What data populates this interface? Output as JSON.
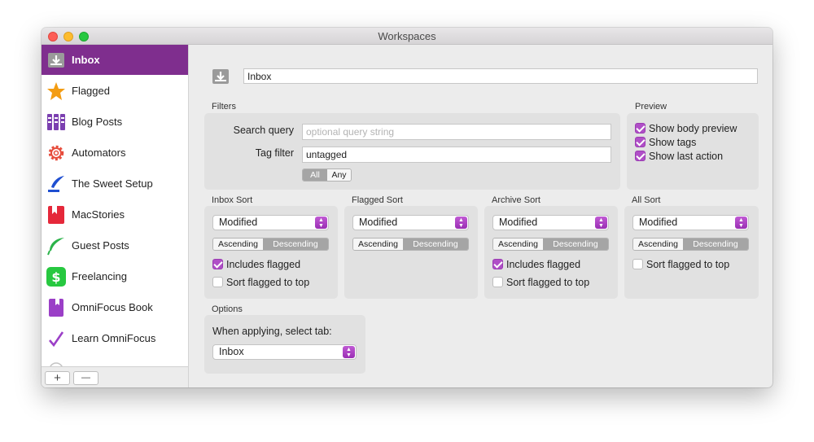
{
  "window": {
    "title": "Workspaces"
  },
  "sidebar": {
    "items": [
      {
        "label": "Inbox",
        "icon": "inbox-icon",
        "color": "#8e8e8e",
        "active": true
      },
      {
        "label": "Flagged",
        "icon": "star-icon",
        "color": "#f39c12"
      },
      {
        "label": "Blog Posts",
        "icon": "columns-icon",
        "color": "#7b3fb0"
      },
      {
        "label": "Automators",
        "icon": "gear-icon",
        "color": "#e74c3c"
      },
      {
        "label": "The Sweet Setup",
        "icon": "quill-icon",
        "color": "#1f4fd1"
      },
      {
        "label": "MacStories",
        "icon": "bookmark-icon",
        "color": "#e5283a"
      },
      {
        "label": "Guest Posts",
        "icon": "feather-icon",
        "color": "#2bb34a"
      },
      {
        "label": "Freelancing",
        "icon": "dollar-icon",
        "color": "#27c840"
      },
      {
        "label": "OmniFocus Book",
        "icon": "book-icon",
        "color": "#9b3fc7"
      },
      {
        "label": "Learn OmniFocus",
        "icon": "checkmark-icon",
        "color": "#9b3fc7"
      }
    ],
    "add_label": "+",
    "remove_label": "—"
  },
  "main": {
    "name_value": "Inbox",
    "filters": {
      "title": "Filters",
      "search_label": "Search query",
      "search_placeholder": "optional query string",
      "tag_label": "Tag filter",
      "tag_value": "untagged",
      "match_options": [
        "All",
        "Any"
      ],
      "match_selected": "All"
    },
    "preview": {
      "title": "Preview",
      "options": [
        {
          "label": "Show body preview",
          "checked": true
        },
        {
          "label": "Show tags",
          "checked": true
        },
        {
          "label": "Show last action",
          "checked": true
        }
      ]
    },
    "sorts": [
      {
        "title": "Inbox Sort",
        "field": "Modified",
        "asc": "Ascending",
        "desc": "Descending",
        "checks": [
          {
            "label": "Includes flagged",
            "checked": true
          },
          {
            "label": "Sort flagged to top",
            "checked": false
          }
        ]
      },
      {
        "title": "Flagged Sort",
        "field": "Modified",
        "asc": "Ascending",
        "desc": "Descending",
        "checks": []
      },
      {
        "title": "Archive Sort",
        "field": "Modified",
        "asc": "Ascending",
        "desc": "Descending",
        "checks": [
          {
            "label": "Includes flagged",
            "checked": true
          },
          {
            "label": "Sort flagged to top",
            "checked": false
          }
        ]
      },
      {
        "title": "All Sort",
        "field": "Modified",
        "asc": "Ascending",
        "desc": "Descending",
        "checks": [
          {
            "label": "Sort flagged to top",
            "checked": false
          }
        ]
      }
    ],
    "options": {
      "title": "Options",
      "select_tab_label": "When applying, select tab:",
      "select_tab_value": "Inbox"
    }
  },
  "colors": {
    "accent": "#7f2e8e",
    "checkbox": "#b04fc7"
  }
}
